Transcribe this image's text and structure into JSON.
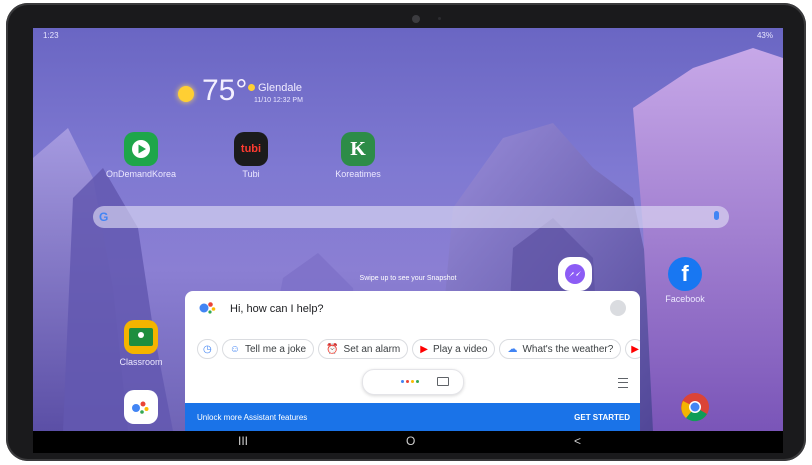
{
  "status_bar": {
    "time": "1:23",
    "right": "43%"
  },
  "weather": {
    "temperature": "75°",
    "location": "Glendale",
    "updated": "11/10 12:32 PM"
  },
  "apps": [
    {
      "name": "OnDemandKorea",
      "color": "#1ea64a"
    },
    {
      "name": "Tubi",
      "color": "#1b1b1b"
    },
    {
      "name": "Koreatimes",
      "color": "#2d8c48"
    },
    {
      "name": "Facebook",
      "color": "#1877f2"
    },
    {
      "name": "Classroom",
      "color": "#1e8e3e"
    }
  ],
  "search_bar": {
    "logo": "G"
  },
  "hint": "Swipe up to see your Snapshot",
  "assistant": {
    "prompt": "Hi, how can I help?",
    "chips": [
      "Tell me a joke",
      "Set an alarm",
      "Play a video",
      "What's the weather?"
    ],
    "banner_text": "Unlock more Assistant features",
    "banner_action": "GET STARTED"
  },
  "nav_bar": {
    "recents": "III",
    "home": "O",
    "back": "<"
  }
}
